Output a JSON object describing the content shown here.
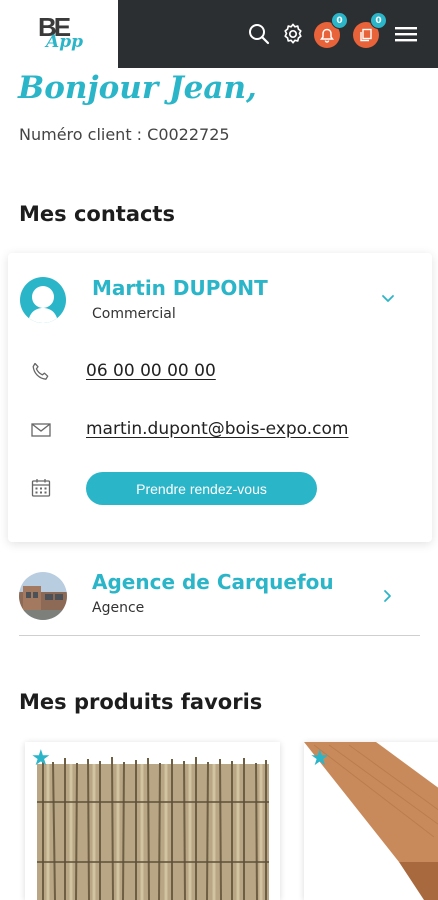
{
  "header": {
    "logo_letters": "BE",
    "logo_app": "App",
    "notifications_count": "0",
    "orders_count": "0",
    "icons": [
      "search-icon",
      "gear-icon",
      "bell-icon",
      "document-icon",
      "hamburger-menu-icon"
    ],
    "colors": {
      "bar": "#2c2f31",
      "accent": "#2bb5c8",
      "badge_orange": "#e8623a"
    }
  },
  "greeting": {
    "title": "Bonjour Jean,",
    "client_number": "Numéro client : C0022725"
  },
  "contacts": {
    "section_title": "Mes contacts",
    "primary": {
      "name": "Martin DUPONT",
      "role": "Commercial",
      "phone": "06 00 00 00 00",
      "email": "martin.dupont@bois-expo.com",
      "appointment_button": "Prendre rendez-vous"
    },
    "agency": {
      "name": "Agence de Carquefou",
      "type": "Agence"
    }
  },
  "favorites": {
    "section_title": "Mes produits favoris",
    "items": [
      {
        "name": "",
        "favorite": true
      },
      {
        "name": "",
        "favorite": true
      }
    ]
  }
}
